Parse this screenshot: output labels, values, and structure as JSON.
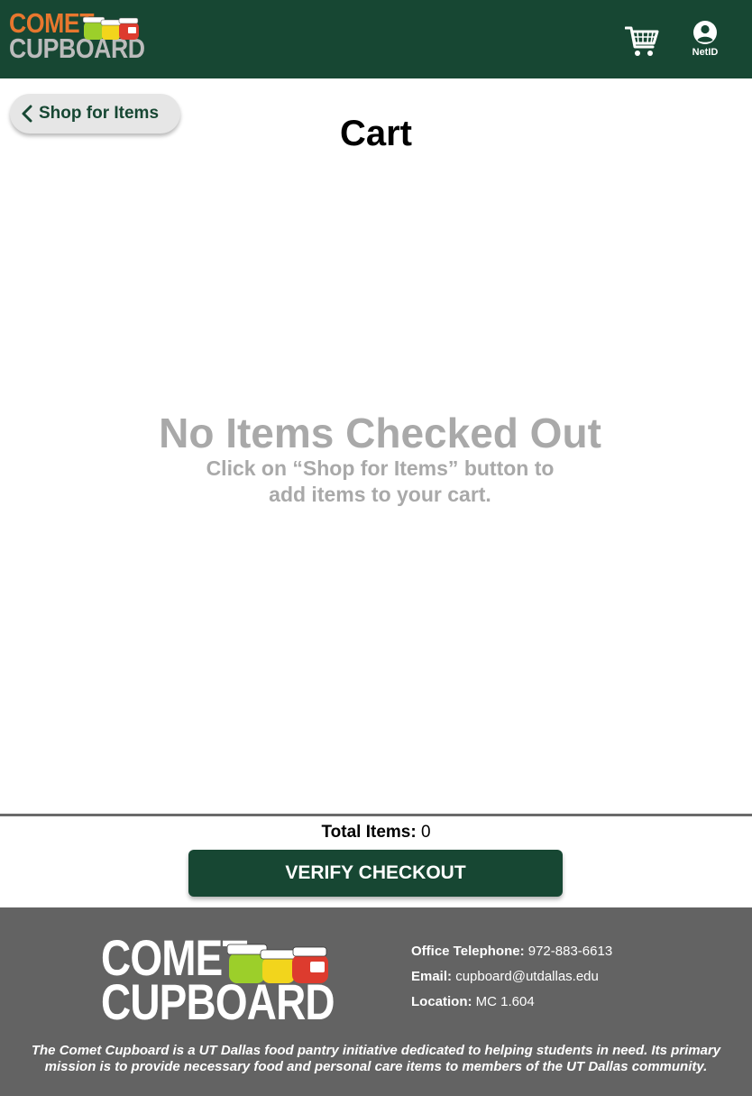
{
  "header": {
    "logo_line1": "COMET",
    "logo_line2": "CUPBOARD",
    "cart_icon": "shopping-cart-icon",
    "netid_icon": "user-circle-icon",
    "netid_label": "NetID"
  },
  "nav": {
    "back_label": "Shop for Items",
    "back_icon": "chevron-left-icon"
  },
  "page": {
    "title": "Cart",
    "empty_title": "No Items Checked Out",
    "empty_sub_line1": "Click on “Shop for Items” button to",
    "empty_sub_line2": "add items to your cart."
  },
  "checkout": {
    "total_label": "Total Items:",
    "total_value": "0",
    "verify_label": "VERIFY CHECKOUT"
  },
  "footer": {
    "logo_line1": "COMET",
    "logo_line2": "CUPBOARD",
    "phone_label": "Office Telephone:",
    "phone_value": "972-883-6613",
    "email_label": "Email:",
    "email_value": "cupboard@utdallas.edu",
    "location_label": "Location:",
    "location_value": "MC 1.604",
    "mission": "The Comet Cupboard is a UT Dallas food pantry initiative dedicated to helping students in need. Its primary mission is to provide necessary food and personal care items to members of the UT Dallas community."
  },
  "colors": {
    "brand_green": "#174733",
    "logo_orange": "#e8772e",
    "footer_gray": "#636363",
    "muted_text": "#a9a9a9"
  }
}
